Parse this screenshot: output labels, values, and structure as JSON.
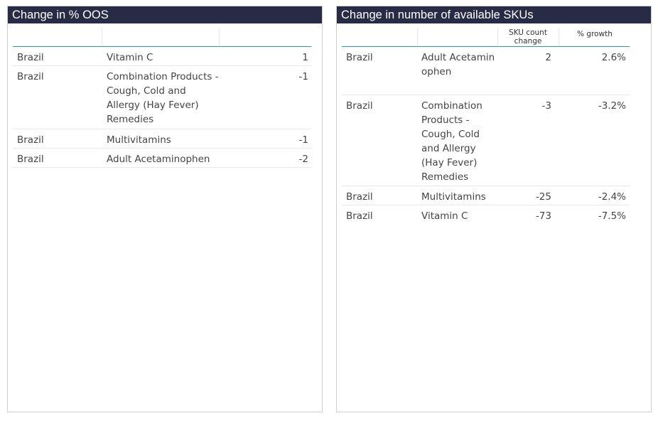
{
  "oos_panel": {
    "title": "Change in % OOS",
    "rows": [
      {
        "country": "Brazil",
        "product": "Vitamin C",
        "value": "1"
      },
      {
        "country": "Brazil",
        "product": "Combination Products - Cough, Cold and Allergy (Hay Fever) Remedies",
        "value": "-1"
      },
      {
        "country": "Brazil",
        "product": "Multivitamins",
        "value": "-1"
      },
      {
        "country": "Brazil",
        "product": "Adult Acetaminophen",
        "value": "-2"
      }
    ]
  },
  "sku_panel": {
    "title": "Change in number of available SKUs",
    "headers": {
      "sku_count_change": "SKU count change",
      "pct_growth": "% growth"
    },
    "rows": [
      {
        "country": "Brazil",
        "product": "Adult Acetaminophen",
        "sku_change": "2",
        "growth": "2.6%"
      },
      {
        "country": "Brazil",
        "product": "Combination Products - Cough, Cold and Allergy (Hay Fever) Remedies",
        "sku_change": "-3",
        "growth": "-3.2%"
      },
      {
        "country": "Brazil",
        "product": "Multivitamins",
        "sku_change": "-25",
        "growth": "-2.4%"
      },
      {
        "country": "Brazil",
        "product": "Vitamin C",
        "sku_change": "-73",
        "growth": "-7.5%"
      }
    ]
  }
}
